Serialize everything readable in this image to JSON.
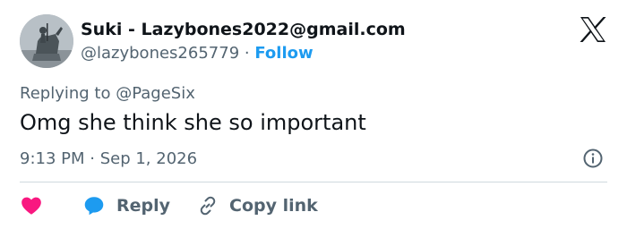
{
  "tweet": {
    "author": {
      "display_name": "Suki - Lazybones2022@gmail.com",
      "handle": "@lazybones265779",
      "separator": "·",
      "follow_label": "Follow",
      "avatar_icon": "statue-avatar"
    },
    "reply_context": {
      "prefix": "Replying to",
      "mention": "@PageSix"
    },
    "text": "Omg she think she so important",
    "timestamp": "9:13 PM · Sep 1, 2026",
    "actions": {
      "like_icon": "heart-icon",
      "reply_label": "Reply",
      "copy_link_label": "Copy link"
    },
    "colors": {
      "accent": "#1d9bf0",
      "like": "#f91880",
      "muted": "#536471",
      "text": "#0f1419"
    }
  }
}
